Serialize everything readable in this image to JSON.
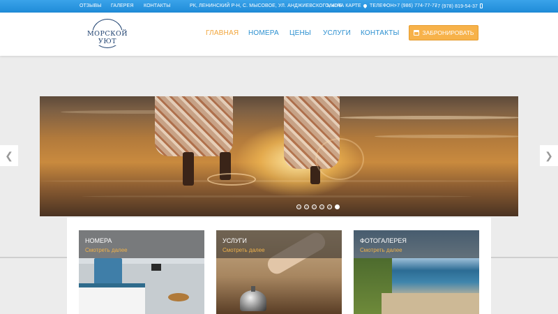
{
  "topbar": {
    "links": [
      "ОТЗЫВЫ",
      "ГАЛЕРЕЯ",
      "КОНТАКТЫ"
    ],
    "address": "РК, ЛЕНИНСКИЙ Р-Н, С. МЫСОВОЕ, УЛ. АНДЖИЕВСКОГО, 40/Б",
    "map_link": "МЫ НА КАРТЕ",
    "phone_label": "ТЕЛЕФОН:",
    "phone1": "+7 (986) 774-77-77",
    "phone2": "+7 (978) 819-54-37"
  },
  "logo": {
    "text": "МОРСКОЙ УЮТ"
  },
  "nav": {
    "items": [
      "ГЛАВНАЯ",
      "НОМЕРА",
      "ЦЕНЫ",
      "УСЛУГИ",
      "КОНТАКТЫ"
    ],
    "active_index": 0,
    "book_label": "ЗАБРОНИРОВАТЬ"
  },
  "slider": {
    "slide_count": 6,
    "active_slide": 6,
    "prev_icon": "chevron-left",
    "next_icon": "chevron-right"
  },
  "cards": [
    {
      "title": "НОМЕРА",
      "more": "Смотреть далее"
    },
    {
      "title": "УСЛУГИ",
      "more": "Смотреть далее"
    },
    {
      "title": "ФОТОГАЛЕРЕЯ",
      "more": "Смотреть далее"
    }
  ],
  "colors": {
    "accent_blue": "#2b8fd0",
    "accent_orange": "#f7b24a",
    "topbar": "#2b93dc"
  }
}
